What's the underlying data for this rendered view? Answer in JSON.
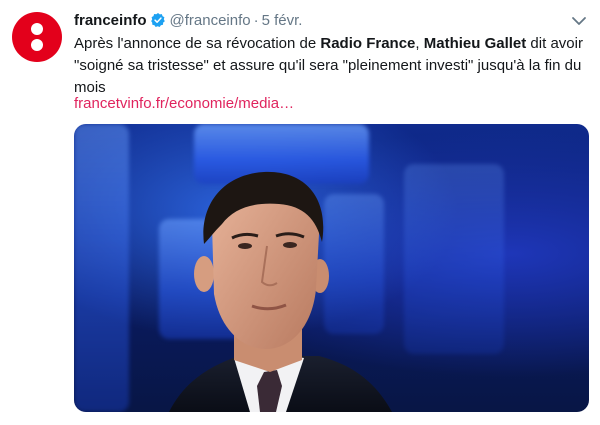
{
  "account": {
    "name": "franceinfo",
    "handle": "@franceinfo",
    "separator": "·",
    "date": "5 févr."
  },
  "tweet": {
    "parts": {
      "p1": "Après l'annonce de sa révocation de ",
      "b1": "Radio France",
      "p2": ", ",
      "b2": "Mathieu Gallet",
      "p3": " dit avoir \"soigné sa tristesse\" et assure qu'il sera \"pleinement investi\" jusqu'à la fin du mois"
    },
    "link": "francetvinfo.fr/economie/media…"
  },
  "colors": {
    "brand": "#e3001b",
    "link": "#e0245e",
    "verified": "#1da1f2",
    "muted": "#657786"
  },
  "icons": {
    "verified": "verified-badge-icon",
    "menu": "chevron-down-icon"
  }
}
